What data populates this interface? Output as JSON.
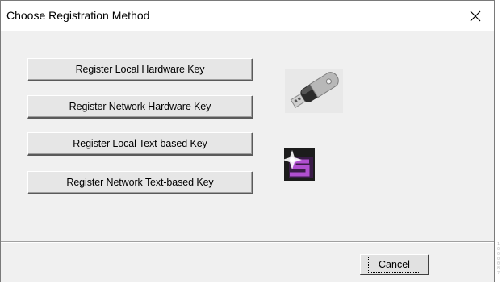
{
  "window": {
    "title": "Choose Registration Method",
    "close_icon": "close-icon"
  },
  "buttons": [
    {
      "label": "Register Local Hardware Key"
    },
    {
      "label": "Register Network Hardware Key"
    },
    {
      "label": "Register Local Text-based Key"
    },
    {
      "label": "Register Network Text-based Key"
    }
  ],
  "icons": {
    "hardware": "usb-key-icon",
    "text": "sentinel-s-logo-icon"
  },
  "footer": {
    "cancel_label": "Cancel"
  },
  "side_mark": "1000087"
}
